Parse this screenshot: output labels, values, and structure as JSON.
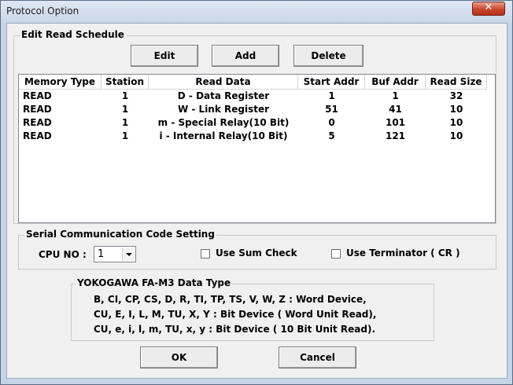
{
  "window": {
    "title": "Protocol Option",
    "close_glyph": "✕"
  },
  "schedule": {
    "group_label": "Edit Read Schedule",
    "buttons": {
      "edit": "Edit",
      "add": "Add",
      "delete": "Delete"
    },
    "columns": [
      "Memory Type",
      "Station",
      "Read Data",
      "Start Addr",
      "Buf Addr",
      "Read Size"
    ],
    "rows": [
      [
        "READ",
        "1",
        "D - Data Register",
        "1",
        "1",
        "32"
      ],
      [
        "READ",
        "1",
        "W - Link Register",
        "51",
        "41",
        "10"
      ],
      [
        "READ",
        "1",
        "m - Special Relay(10 Bit)",
        "0",
        "101",
        "10"
      ],
      [
        "READ",
        "1",
        "i - Internal Relay(10 Bit)",
        "5",
        "121",
        "10"
      ]
    ]
  },
  "serial": {
    "group_label": "Serial Communication Code Setting",
    "cpu_label": "CPU NO :",
    "cpu_value": "1",
    "sum_check_label": "Use Sum Check",
    "sum_check_checked": false,
    "terminator_label": "Use Terminator ( CR )",
    "terminator_checked": false
  },
  "datatype": {
    "group_label": "YOKOGAWA FA-M3 Data Type",
    "lines": [
      "B,  CI,  CP,  CS,  D,  R,  TI,  TP,  TS, V,  W,  Z  :  Word Device,",
      "CU, E,  I,  L,  M,  TU,  X,  Y  :  Bit Device ( Word Unit Read),",
      "CU,  e,  i,  l,  m,  TU,  x,  y  :  Bit Device ( 10 Bit Unit Read)."
    ]
  },
  "footer": {
    "ok": "OK",
    "cancel": "Cancel"
  }
}
